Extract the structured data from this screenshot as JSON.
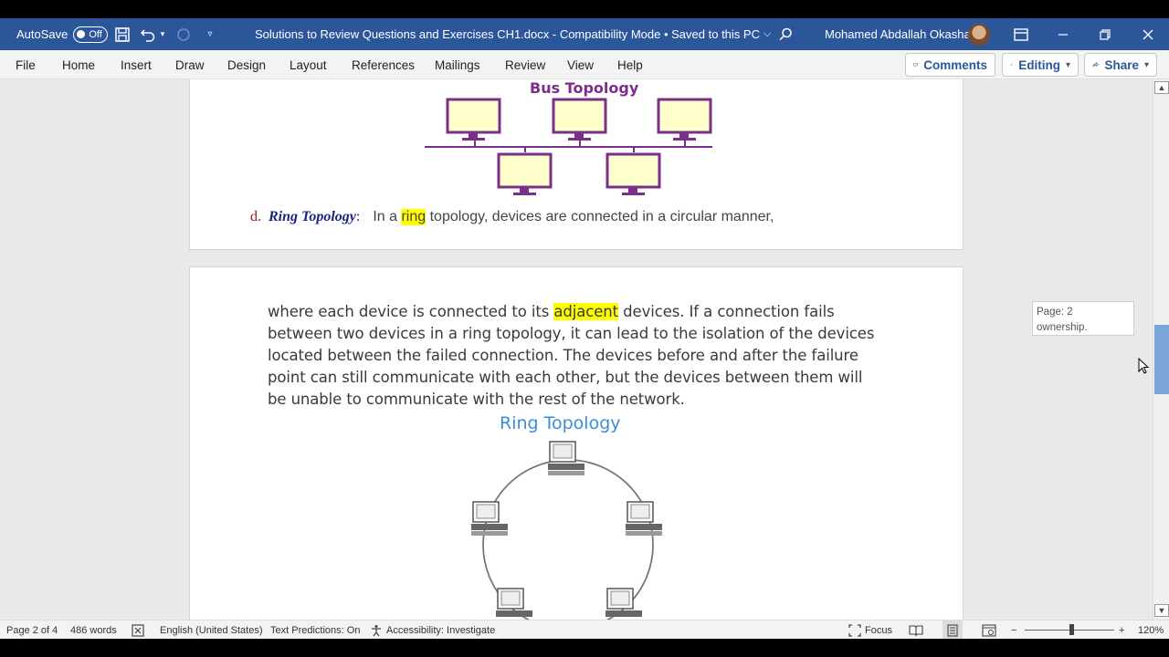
{
  "titlebar": {
    "autosave_label": "AutoSave",
    "autosave_state": "Off",
    "doc_title": "Solutions to Review Questions and Exercises CH1.docx  -  Compatibility Mode • Saved to this PC",
    "user_name": "Mohamed Abdallah Okasha"
  },
  "ribbon": {
    "tabs": [
      "File",
      "Home",
      "Insert",
      "Draw",
      "Design",
      "Layout",
      "References",
      "Mailings",
      "Review",
      "View",
      "Help"
    ],
    "comments_label": "Comments",
    "editing_label": "Editing",
    "share_label": "Share"
  },
  "document": {
    "bus_title": "Bus Topology",
    "item_letter": "d.",
    "item_term": "Ring Topology",
    "item_colon": ":",
    "item_text_pre": "In a ",
    "item_text_hl": "ring",
    "item_text_post": " topology, devices are connected in a circular manner,",
    "para_line1_pre": "where each device is connected to its ",
    "para_line1_hl": "adjacent",
    "para_line1_post": " devices. If a connection fails",
    "para_lines": [
      "between two devices in a ring topology, it can lead to the isolation of the devices",
      "located between the failed connection. The devices before and after the failure",
      "point can still communicate with each other, but the devices between them will",
      "be unable to communicate with the rest of the network."
    ],
    "ring_title": "Ring Topology"
  },
  "comment": {
    "line1": "Page: 2",
    "line2": "ownership."
  },
  "statusbar": {
    "page": "Page 2 of 4",
    "words": "486 words",
    "language": "English (United States)",
    "predictions": "Text Predictions: On",
    "accessibility": "Accessibility: Investigate",
    "focus": "Focus",
    "zoom": "120%"
  },
  "colors": {
    "titlebar": "#2b579a",
    "bus_purple": "#7b2f8a",
    "monitor_fill": "#ffffcc",
    "highlight": "#ffff00",
    "ring_title": "#3d8ed6"
  }
}
